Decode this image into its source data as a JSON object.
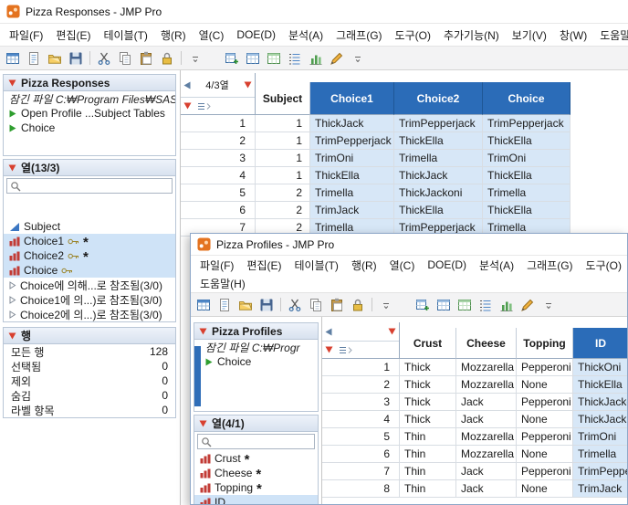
{
  "colors": {
    "header_blue": "#2b6cb8",
    "selected_cell": "#d7e7f7",
    "selected_item": "#cfe3f7",
    "red_triangle": "#d8402f",
    "green_triangle": "#2f9e2f"
  },
  "icons": {
    "app": "jmp-logo",
    "panel_collapse": "red-triangle",
    "script": "green-triangle",
    "search": "magnifier",
    "corner_left": "left-triangle",
    "corner_rows": "row-markers",
    "group_closed": "disclosure-right"
  },
  "responses_window": {
    "titlebar": {
      "title": "Pizza Responses - JMP Pro"
    },
    "menu": [
      "파일(F)",
      "편집(E)",
      "테이블(T)",
      "행(R)",
      "열(C)",
      "DOE(D)",
      "분석(A)",
      "그래프(G)",
      "도구(O)",
      "추가기능(N)",
      "보기(V)",
      "창(W)",
      "도움말(H)"
    ],
    "toolbar_icons": [
      "new-table",
      "journal",
      "open",
      "save",
      "sep",
      "cut",
      "copy",
      "paste",
      "lock",
      "sep",
      "dropdown",
      "gap",
      "table-sum",
      "table-grid",
      "table-grid2",
      "list-view",
      "chart-bar",
      "pencil",
      "dropdown"
    ],
    "table_panel": {
      "title": "Pizza Responses",
      "locked_file": "잠긴 파일  C:₩Program Files₩SAS",
      "scripts": [
        {
          "label": "Open Profile ...Subject Tables"
        },
        {
          "label": "Choice"
        }
      ]
    },
    "columns_panel": {
      "title": "열(13/3)",
      "items": [
        {
          "label": "Subject",
          "icon": "continuous"
        },
        {
          "label": "Choice1",
          "icon": "nominal",
          "suffix_icon": "key",
          "star": "*",
          "selected": true
        },
        {
          "label": "Choice2",
          "icon": "nominal",
          "suffix_icon": "key",
          "star": "*",
          "selected": true
        },
        {
          "label": "Choice",
          "icon": "nominal",
          "suffix_icon": "key",
          "selected": true
        },
        {
          "label": "Choice에 의해...로 참조됨(3/0)",
          "icon": "disclosure-right"
        },
        {
          "label": "Choice1에 의...)로 참조됨(3/0)",
          "icon": "disclosure-right"
        },
        {
          "label": "Choice2에 의...)로 참조됨(3/0)",
          "icon": "disclosure-right"
        }
      ]
    },
    "rows_panel": {
      "title": "행",
      "stats": [
        {
          "label": "모든 행",
          "value": "128"
        },
        {
          "label": "선택됨",
          "value": "0"
        },
        {
          "label": "제외",
          "value": "0"
        },
        {
          "label": "숨김",
          "value": "0"
        },
        {
          "label": "라벨 항목",
          "value": "0"
        }
      ]
    },
    "grid": {
      "corner_label": "4/3열",
      "columns": [
        {
          "label": "Subject",
          "selected": false
        },
        {
          "label": "Choice1",
          "selected": true
        },
        {
          "label": "Choice2",
          "selected": true
        },
        {
          "label": "Choice",
          "selected": true
        }
      ],
      "rows": [
        {
          "n": "1",
          "cells": [
            "1",
            "ThickJack",
            "TrimPepperjack",
            "TrimPepperjack"
          ]
        },
        {
          "n": "2",
          "cells": [
            "1",
            "TrimPepperjack",
            "ThickElla",
            "ThickElla"
          ]
        },
        {
          "n": "3",
          "cells": [
            "1",
            "TrimOni",
            "Trimella",
            "TrimOni"
          ]
        },
        {
          "n": "4",
          "cells": [
            "1",
            "ThickElla",
            "ThickJack",
            "ThickElla"
          ]
        },
        {
          "n": "5",
          "cells": [
            "2",
            "Trimella",
            "ThickJackoni",
            "Trimella"
          ]
        },
        {
          "n": "6",
          "cells": [
            "2",
            "TrimJack",
            "ThickElla",
            "ThickElla"
          ]
        },
        {
          "n": "7",
          "cells": [
            "2",
            "Trimella",
            "TrimPepperjack",
            "Trimella"
          ]
        }
      ]
    }
  },
  "profiles_window": {
    "titlebar": {
      "title": "Pizza Profiles - JMP Pro"
    },
    "menu_row1": [
      "파일(F)",
      "편집(E)",
      "테이블(T)",
      "행(R)",
      "열(C)",
      "DOE(D)",
      "분석(A)",
      "그래프(G)",
      "도구(O)"
    ],
    "menu_row2": [
      "도움말(H)"
    ],
    "toolbar_icons": [
      "new-table",
      "journal",
      "open",
      "save",
      "sep",
      "cut",
      "copy",
      "paste",
      "lock",
      "sep",
      "dropdown",
      "gap",
      "table-sum",
      "table-grid",
      "table-grid2",
      "list-view",
      "chart-bar",
      "pencil",
      "dropdown"
    ],
    "table_panel": {
      "title": "Pizza Profiles",
      "locked_file": "잠긴 파일  C:₩Progr",
      "scripts": [
        {
          "label": "Choice"
        }
      ]
    },
    "columns_panel": {
      "title": "열(4/1)",
      "items": [
        {
          "label": "Crust",
          "icon": "nominal",
          "star": "*"
        },
        {
          "label": "Cheese",
          "icon": "nominal",
          "star": "*"
        },
        {
          "label": "Topping",
          "icon": "nominal",
          "star": "*"
        },
        {
          "label": "ID",
          "icon": "nominal",
          "selected": true
        }
      ]
    },
    "grid": {
      "corner_label": "",
      "columns": [
        {
          "label": "Crust",
          "selected": false
        },
        {
          "label": "Cheese",
          "selected": false
        },
        {
          "label": "Topping",
          "selected": false
        },
        {
          "label": "ID",
          "selected": true
        }
      ],
      "rows": [
        {
          "n": "1",
          "cells": [
            "Thick",
            "Mozzarella",
            "Pepperoni",
            "ThickOni"
          ]
        },
        {
          "n": "2",
          "cells": [
            "Thick",
            "Mozzarella",
            "None",
            "ThickElla"
          ]
        },
        {
          "n": "3",
          "cells": [
            "Thick",
            "Jack",
            "Pepperoni",
            "ThickJackoni"
          ]
        },
        {
          "n": "4",
          "cells": [
            "Thick",
            "Jack",
            "None",
            "ThickJack"
          ]
        },
        {
          "n": "5",
          "cells": [
            "Thin",
            "Mozzarella",
            "Pepperoni",
            "TrimOni"
          ]
        },
        {
          "n": "6",
          "cells": [
            "Thin",
            "Mozzarella",
            "None",
            "Trimella"
          ]
        },
        {
          "n": "7",
          "cells": [
            "Thin",
            "Jack",
            "Pepperoni",
            "TrimPepperjack"
          ]
        },
        {
          "n": "8",
          "cells": [
            "Thin",
            "Jack",
            "None",
            "TrimJack"
          ]
        }
      ]
    }
  }
}
